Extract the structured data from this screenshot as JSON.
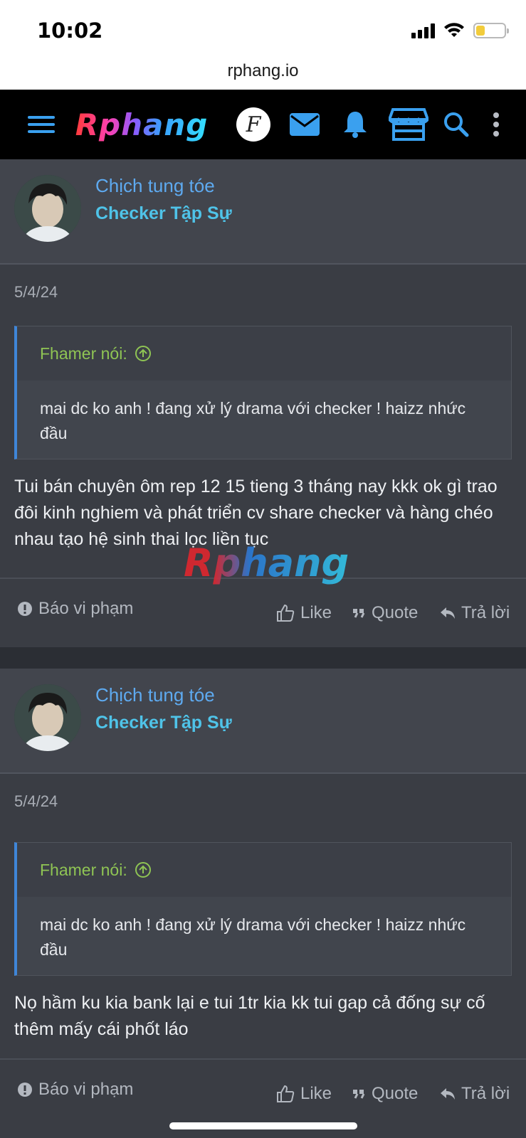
{
  "status_bar": {
    "time": "10:02"
  },
  "browser": {
    "url": "rphang.io"
  },
  "nav": {
    "logo": "Rphang",
    "f_badge": "F",
    "icons": [
      "menu-icon",
      "logo",
      "forum-badge-icon",
      "mail-icon",
      "bell-icon",
      "store-icon",
      "search-icon",
      "more-vertical-icon"
    ]
  },
  "watermark": "Rphang",
  "posts": [
    {
      "username": "Chịch tung tóe",
      "user_title": "Checker Tập Sự",
      "date": "5/4/24",
      "quote_author": "Fhamer nói:",
      "quote_text": "mai dc ko anh ! đang xử lý drama với checker ! haizz nhức đầu",
      "text": "Tui bán chuyên ôm rep 12 15 tieng 3 tháng nay kkk ok gì trao đôi kinh nghiem và phát triển cv share checker và hàng chéo nhau tạo hệ sinh thai lọc liền tục",
      "report_label": "Báo vi phạm",
      "like_label": "Like",
      "quote_label": "Quote",
      "reply_label": "Trả lời"
    },
    {
      "username": "Chịch tung tóe",
      "user_title": "Checker Tập Sự",
      "date": "5/4/24",
      "quote_author": "Fhamer nói:",
      "quote_text": "mai dc ko anh ! đang xử lý drama với checker ! haizz nhức đầu",
      "text": "Nọ hầm ku kia bank lại e tui 1tr kia kk tui gap cả đống sự cố thêm mấy cái phốt láo",
      "report_label": "Báo vi phạm",
      "like_label": "Like",
      "quote_label": "Quote",
      "reply_label": "Trả lời"
    }
  ],
  "colors": {
    "accent_blue": "#3f86d8",
    "username": "#5eaaf0",
    "user_title": "#4fc3e8",
    "quote_author": "#8fc454",
    "nav_icon": "#3aa0ef"
  }
}
